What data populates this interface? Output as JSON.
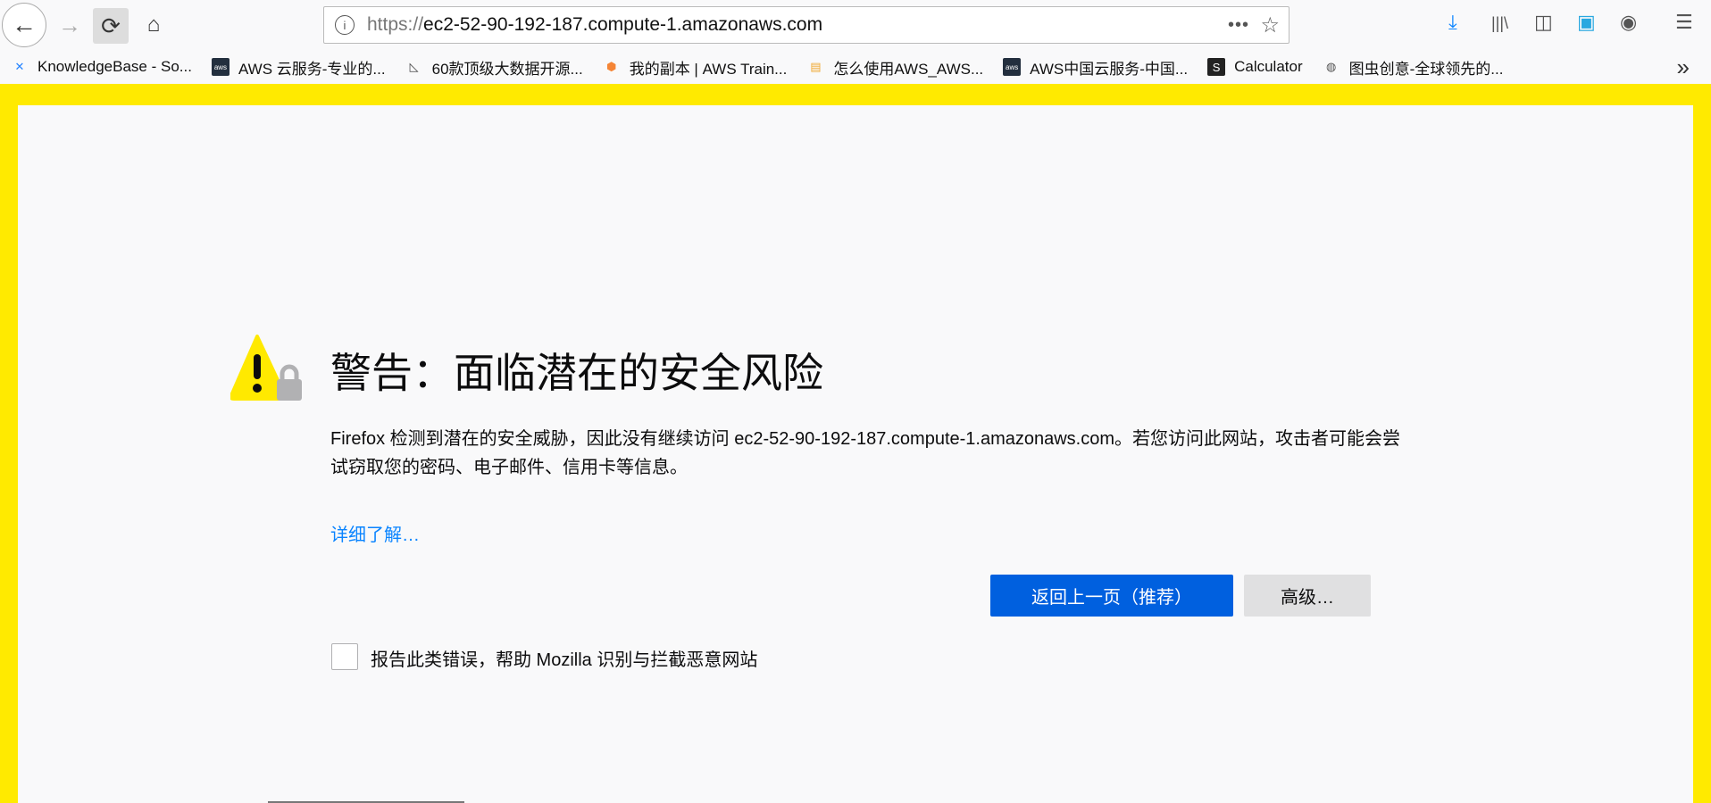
{
  "toolbar": {
    "back_icon": "←",
    "forward_icon": "→",
    "reload_icon": "⟳",
    "home_icon": "⌂",
    "url_scheme": "https://",
    "url_host": "ec2-52-90-192-187.compute-1.amazonaws.com",
    "more_icon": "•••",
    "star_icon": "☆",
    "right_icons": {
      "download": "⤓",
      "library": "|||\\",
      "sidebar": "◫",
      "screenshot": "▣",
      "account": "◉",
      "menu": "☰"
    }
  },
  "bookmarks": [
    {
      "label": "KnowledgeBase - So...",
      "icon": "✕",
      "color": "#2684ff",
      "bg": "transparent"
    },
    {
      "label": "AWS 云服务-专业的...",
      "icon": "aws",
      "color": "#fff",
      "bg": "#232f3e"
    },
    {
      "label": "60款顶级大数据开源...",
      "icon": "◺",
      "color": "#444",
      "bg": "transparent"
    },
    {
      "label": "我的副本 | AWS Train...",
      "icon": "⬢",
      "color": "#f58536",
      "bg": "transparent"
    },
    {
      "label": "怎么使用AWS_AWS...",
      "icon": "▤",
      "color": "#f0a830",
      "bg": "transparent"
    },
    {
      "label": "AWS中国云服务-中国...",
      "icon": "aws",
      "color": "#fff",
      "bg": "#232f3e"
    },
    {
      "label": "Calculator",
      "icon": "S",
      "color": "#fff",
      "bg": "#222"
    },
    {
      "label": "图虫创意-全球领先的...",
      "icon": "◍",
      "color": "#555",
      "bg": "transparent"
    }
  ],
  "overflow_icon": "»",
  "page": {
    "title": "警告：面临潜在的安全风险",
    "description": "Firefox 检测到潜在的安全威胁，因此没有继续访问 ec2-52-90-192-187.compute-1.amazonaws.com。若您访问此网站，攻击者可能会尝试窃取您的密码、电子邮件、信用卡等信息。",
    "learn_more": "详细了解…",
    "go_back": "返回上一页（推荐）",
    "advanced": "高级…",
    "report_label": "报告此类错误，帮助 Mozilla 识别与拦截恶意网站",
    "report_checked": false
  },
  "colors": {
    "accent": "#0060df",
    "frame": "#ffea00",
    "link": "#0a84ff"
  }
}
